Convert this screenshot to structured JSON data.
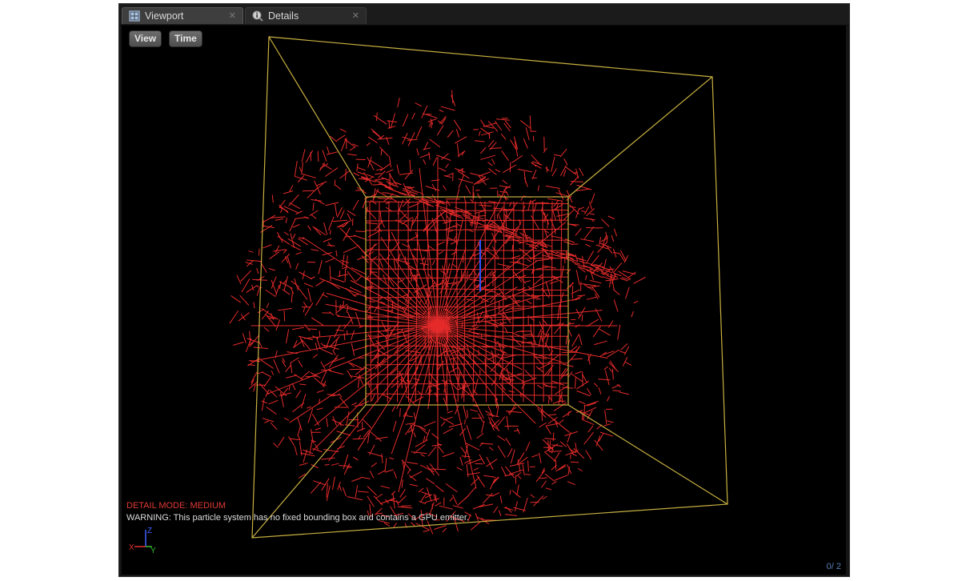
{
  "tabs": [
    {
      "label": "Viewport",
      "icon": "viewport-grid-icon",
      "active": true
    },
    {
      "label": "Details",
      "icon": "details-info-icon",
      "active": false
    }
  ],
  "toolbar": {
    "view_label": "View",
    "time_label": "Time"
  },
  "overlay": {
    "detail_mode": "DETAIL MODE: MEDIUM",
    "warning": "WARNING: This particle system has no fixed bounding box and contains a GPU emitter.",
    "axis": {
      "z": "Z",
      "x": "X",
      "y": "Y"
    },
    "counter": "0/ 2"
  },
  "colors": {
    "particle": "#ff3030",
    "bounds": "#c8b040",
    "detail_mode_text": "#e03a34",
    "axis_x": "#e03030",
    "axis_y": "#30c030",
    "axis_z": "#4060ff"
  }
}
